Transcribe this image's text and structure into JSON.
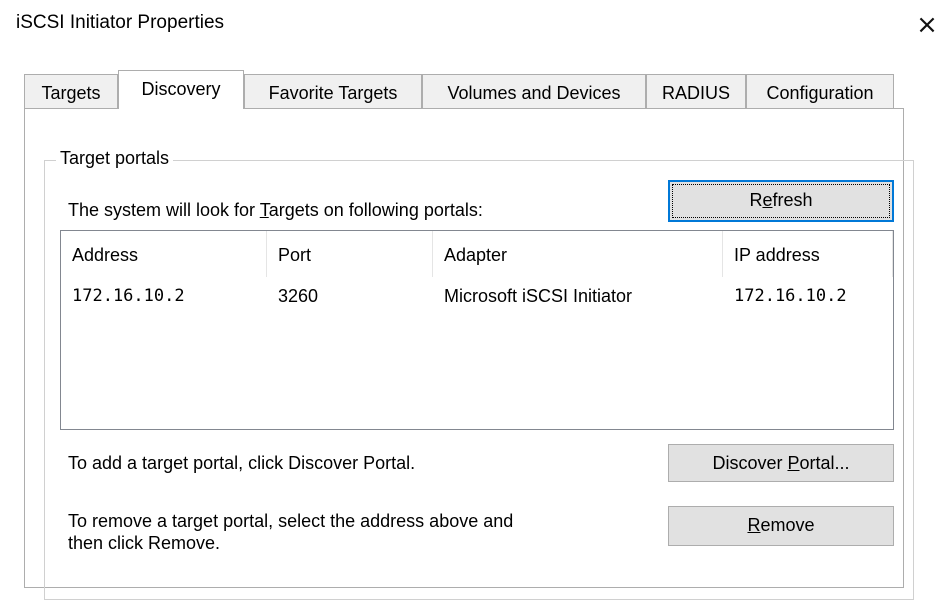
{
  "window": {
    "title": "iSCSI Initiator Properties",
    "close_glyph": "×"
  },
  "tabs": [
    {
      "label": "Targets",
      "active": false
    },
    {
      "label": "Discovery",
      "active": true
    },
    {
      "label": "Favorite Targets",
      "active": false
    },
    {
      "label": "Volumes and Devices",
      "active": false
    },
    {
      "label": "RADIUS",
      "active": false
    },
    {
      "label": "Configuration",
      "active": false
    }
  ],
  "target_portals": {
    "group_label": "Target portals",
    "intro_pre": "The system will look for ",
    "intro_accel": "T",
    "intro_post": "argets on following portals:",
    "refresh_pre": "R",
    "refresh_accel": "e",
    "refresh_post": "fresh",
    "columns": [
      "Address",
      "Port",
      "Adapter",
      "IP address"
    ],
    "rows": [
      {
        "address": "172.16.10.2",
        "port": "3260",
        "adapter": "Microsoft iSCSI Initiator",
        "ip": "172.16.10.2"
      }
    ],
    "add_hint": "To add a target portal, click Discover Portal.",
    "discover_pre": "Discover ",
    "discover_accel": "P",
    "discover_post": "ortal...",
    "remove_hint_line1": "To remove a target portal, select the address above and",
    "remove_hint_line2": "then click Remove.",
    "remove_accel": "R",
    "remove_post": "emove"
  }
}
